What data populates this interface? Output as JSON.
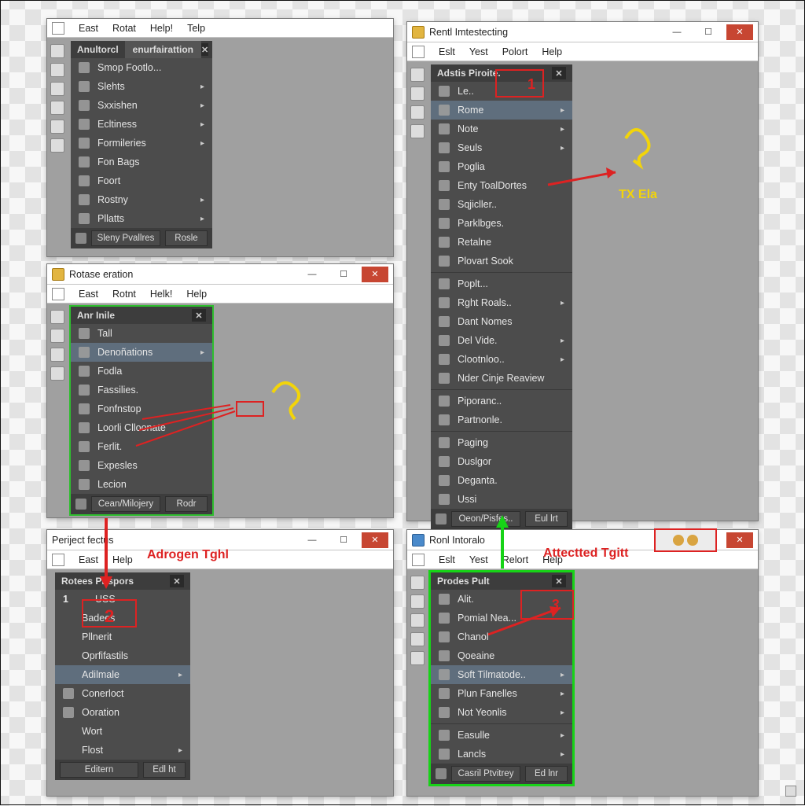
{
  "win1": {
    "menus": [
      "East",
      "Rotat",
      "Help!",
      "Telp"
    ],
    "panel_title": "Anultorcl",
    "panel_tab": "enurfairattion",
    "items": [
      {
        "label": "Smop Footlo...",
        "icon": "star",
        "sub": false
      },
      {
        "label": "Slehts",
        "icon": "pins",
        "sub": true
      },
      {
        "label": "Sxxishen",
        "icon": "folder",
        "sub": true
      },
      {
        "label": "Ecltiness",
        "icon": "folder",
        "sub": true
      },
      {
        "label": "Formileries",
        "icon": "wrench",
        "sub": true
      },
      {
        "label": "Fon Bags",
        "icon": "pen",
        "sub": false
      },
      {
        "label": "Foort",
        "icon": "chart",
        "sub": false
      },
      {
        "label": "Rostny",
        "icon": "rings",
        "sub": true
      },
      {
        "label": "Pllatts",
        "icon": "grid",
        "sub": true
      }
    ],
    "foot": {
      "left": "Sleny Pvallres",
      "right": "Rosle"
    }
  },
  "win2": {
    "title": "Rotase eration",
    "menus": [
      "East",
      "Rotnt",
      "Helk!",
      "Help"
    ],
    "panel_title": "Anr Inile",
    "items": [
      {
        "label": "Tall",
        "icon": "flag",
        "sub": false
      },
      {
        "label": "Denoñations",
        "icon": "card",
        "sub": true,
        "sel": true
      },
      {
        "label": "Fodla",
        "icon": "doc",
        "sub": false
      },
      {
        "label": "Fassilies.",
        "icon": "folder",
        "sub": false
      },
      {
        "label": "Fonfnstop",
        "icon": "folder",
        "sub": false
      },
      {
        "label": "Loorli Clloonate",
        "icon": "pic",
        "sub": false
      },
      {
        "label": "Ferlit.",
        "icon": "panel",
        "sub": false
      },
      {
        "label": "Expesles",
        "icon": "puzzle",
        "sub": false
      },
      {
        "label": "Lecion",
        "icon": "coin",
        "sub": false
      }
    ],
    "foot": {
      "left": "Cean/Milojery",
      "right": "Rodr"
    }
  },
  "win3": {
    "title": "Periject fectus",
    "menus": [
      "East",
      "Help"
    ],
    "panel_title": "Rotees Pirspors",
    "items": [
      {
        "label": "USS",
        "icon": "",
        "sub": false,
        "prefix": "1"
      },
      {
        "label": "Badees",
        "icon": "",
        "sub": false
      },
      {
        "label": "Pllnerit",
        "icon": "",
        "sub": false
      },
      {
        "label": "Oprfifastils",
        "icon": "",
        "sub": false
      },
      {
        "label": "Adilmale",
        "icon": "",
        "sub": true,
        "sel": true
      },
      {
        "label": "Conerloct",
        "icon": "disk",
        "sub": false
      },
      {
        "label": "Ooration",
        "icon": "gear",
        "sub": false
      },
      {
        "label": "Wort",
        "icon": "",
        "sub": false
      },
      {
        "label": "Flost",
        "icon": "",
        "sub": true
      }
    ],
    "foot": {
      "left": "Editern",
      "right": "Edl ht"
    }
  },
  "win4": {
    "title": "Rentl Imtestecting",
    "menus": [
      "Eslt",
      "Yest",
      "Polort",
      "Help"
    ],
    "panel_title": "Adstis Piroite.",
    "items": [
      {
        "label": "Le..",
        "icon": "layers",
        "sub": false
      },
      {
        "label": "Rome",
        "icon": "card",
        "sub": true,
        "sel": true
      },
      {
        "label": "Note",
        "icon": "doc",
        "sub": true
      },
      {
        "label": "Seuls",
        "icon": "star",
        "sub": true
      },
      {
        "label": "Poglia",
        "icon": "folder",
        "sub": false
      },
      {
        "label": "Enty ToalDortes",
        "icon": "plug",
        "sub": false
      },
      {
        "label": "Sqjicller..",
        "icon": "slider",
        "sub": false
      },
      {
        "label": "Parklbges.",
        "icon": "box",
        "sub": false
      },
      {
        "label": "Retalne",
        "icon": "globe",
        "sub": false
      },
      {
        "label": "Plovart Sook",
        "icon": "disc",
        "sub": false
      },
      {
        "label": "Poplt...",
        "icon": "terminal",
        "sub": false
      },
      {
        "label": "Rght Roals..",
        "icon": "tree",
        "sub": true
      },
      {
        "label": "Dant Nomes",
        "icon": "people",
        "sub": false
      },
      {
        "label": "Del Vide.",
        "icon": "film",
        "sub": true
      },
      {
        "label": "Clootnloo..",
        "icon": "cloud",
        "sub": true
      },
      {
        "label": "Nder Cinje Reaview",
        "icon": "shield",
        "sub": false
      },
      {
        "label": "Piporanc..",
        "icon": "gear",
        "sub": false
      },
      {
        "label": "Partnonle.",
        "icon": "gear",
        "sub": false
      },
      {
        "label": "Paging",
        "icon": "arrow",
        "sub": false
      },
      {
        "label": "Duslgor",
        "icon": "key",
        "sub": false
      },
      {
        "label": "Deganta.",
        "icon": "brick",
        "sub": false
      },
      {
        "label": "Ussi",
        "icon": "user",
        "sub": false
      }
    ],
    "separators_after": [
      9,
      15,
      17
    ],
    "foot": {
      "left": "Oeon/Pisfes..",
      "right": "Eul lrt"
    }
  },
  "win5": {
    "title": "Ronl Intoralo",
    "menus": [
      "Eslt",
      "Yest",
      "Relort",
      "Help"
    ],
    "panel_title": "Prodes Pult",
    "items": [
      {
        "label": "Alit.",
        "icon": "star",
        "sub": false
      },
      {
        "label": "Pomial Nea...",
        "icon": "folder",
        "sub": false
      },
      {
        "label": "Chanol",
        "icon": "dot",
        "sub": false
      },
      {
        "label": "Qoeaine",
        "icon": "grid",
        "sub": false
      },
      {
        "label": "Soft Tilmatode..",
        "icon": "wand",
        "sub": true,
        "sel": true
      },
      {
        "label": "Plun Fanelles",
        "icon": "star",
        "sub": true
      },
      {
        "label": "Not Yeonlis",
        "icon": "star",
        "sub": true
      },
      {
        "label": "Easulle",
        "icon": "layers",
        "sub": true
      },
      {
        "label": "Lancls",
        "icon": "bars",
        "sub": true
      }
    ],
    "separators_after": [
      6
    ],
    "foot": {
      "left": "Casril Ptvitrey",
      "right": "Ed lnr"
    }
  },
  "annotations": {
    "adrogen": "Adrogen Tghl",
    "attected": "Attectted Tgitt",
    "tx": "TX Ela",
    "num2": "2",
    "num1": "1",
    "num3": "3"
  }
}
